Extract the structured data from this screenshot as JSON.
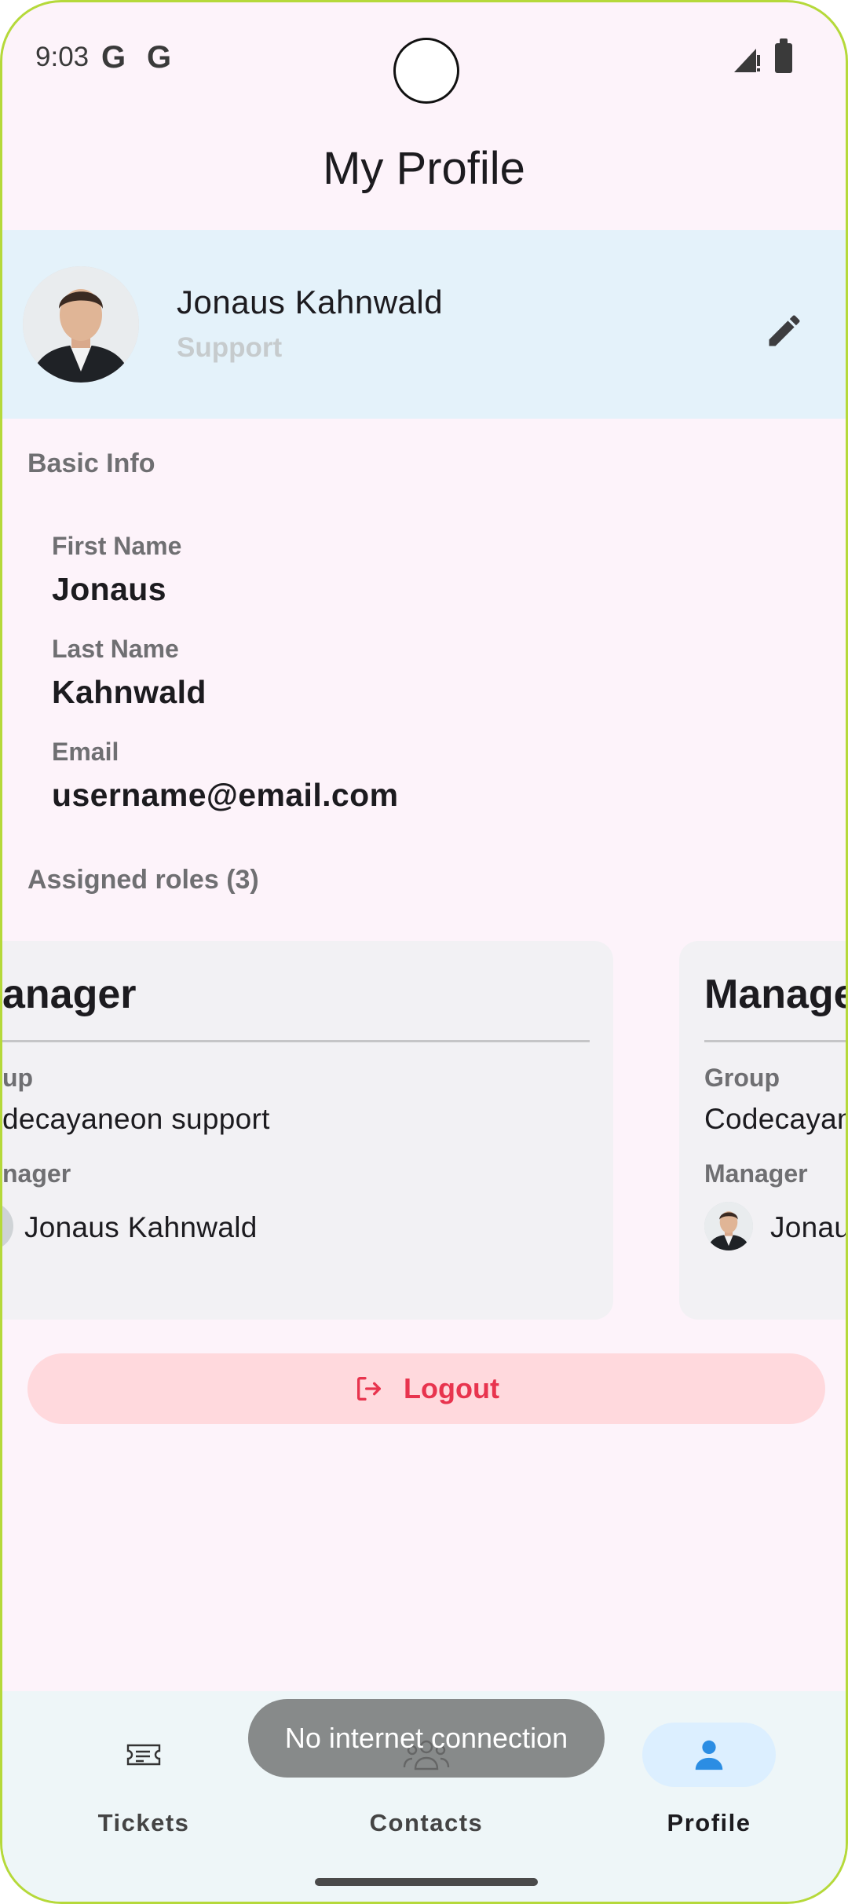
{
  "status_bar": {
    "time": "9:03",
    "notif_icons": [
      "G",
      "G"
    ]
  },
  "app_bar": {
    "title": "My Profile"
  },
  "profile": {
    "name": "Jonaus Kahnwald",
    "role": "Support"
  },
  "basic_info": {
    "section_label": "Basic Info",
    "fields": [
      {
        "label": "First Name",
        "value": "Jonaus"
      },
      {
        "label": "Last Name",
        "value": "Kahnwald"
      },
      {
        "label": "Email",
        "value": "username@email.com"
      }
    ]
  },
  "assigned_roles": {
    "section_label": "Assigned roles (3)",
    "cards": [
      {
        "title": "anager",
        "group_label": "up",
        "group_value": "decayaneon support",
        "manager_label": "nager",
        "manager_name": "Jonaus Kahnwald"
      },
      {
        "title": "Manage",
        "group_label": "Group",
        "group_value": "Codecayan",
        "manager_label": "Manager",
        "manager_name": "Jonau"
      }
    ]
  },
  "logout": {
    "label": "Logout"
  },
  "bottom_nav": {
    "items": [
      {
        "label": "Tickets",
        "icon": "ticket-icon",
        "active": false
      },
      {
        "label": "Contacts",
        "icon": "contacts-icon",
        "active": false
      },
      {
        "label": "Profile",
        "icon": "person-icon",
        "active": true
      }
    ]
  },
  "toast": {
    "text": "No internet connection"
  },
  "colors": {
    "accent_logout": "#e8344e",
    "header_bg": "#e4f2fa",
    "nav_active": "#2b8de3"
  }
}
